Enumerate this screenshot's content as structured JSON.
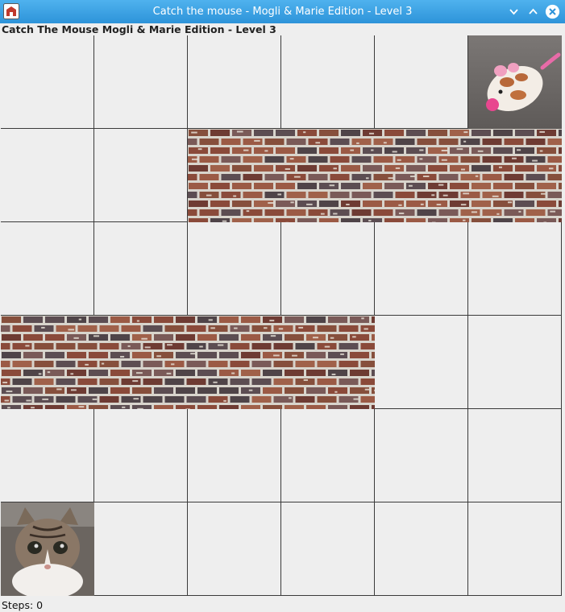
{
  "window": {
    "title": "Catch the mouse - Mogli & Marie Edition - Level 3",
    "controls": [
      "minimize-icon",
      "maximize-icon",
      "close-icon"
    ]
  },
  "game": {
    "header": "Catch The Mouse Mogli & Marie Edition - Level 3",
    "steps_label": "Steps: 0",
    "columns": 6,
    "rows": 6,
    "walls": [
      {
        "row": 1,
        "col_start": 2,
        "col_end": 5
      },
      {
        "row": 3,
        "col_start": 0,
        "col_end": 3
      }
    ],
    "mouse": {
      "row": 0,
      "col": 5,
      "icon": "mouse-icon"
    },
    "cat": {
      "row": 5,
      "col": 0,
      "icon": "cat-icon"
    }
  }
}
